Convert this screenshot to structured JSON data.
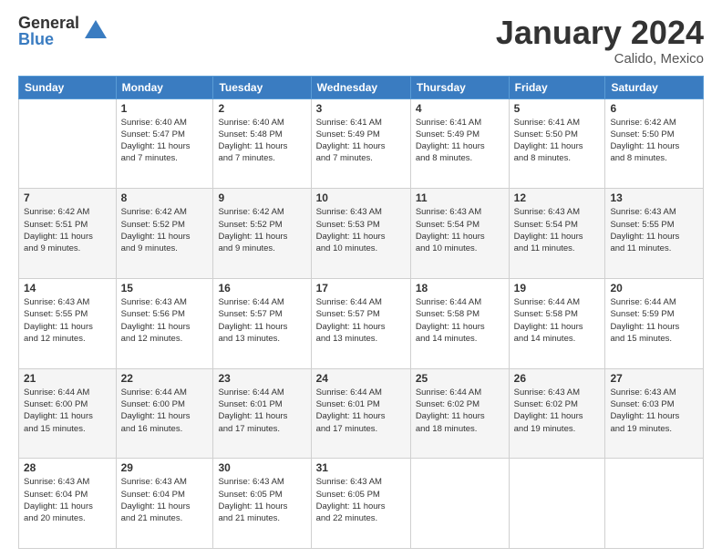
{
  "logo": {
    "general": "General",
    "blue": "Blue"
  },
  "title": "January 2024",
  "location": "Calido, Mexico",
  "days_header": [
    "Sunday",
    "Monday",
    "Tuesday",
    "Wednesday",
    "Thursday",
    "Friday",
    "Saturday"
  ],
  "weeks": [
    [
      {
        "day": "",
        "info": ""
      },
      {
        "day": "1",
        "info": "Sunrise: 6:40 AM\nSunset: 5:47 PM\nDaylight: 11 hours\nand 7 minutes."
      },
      {
        "day": "2",
        "info": "Sunrise: 6:40 AM\nSunset: 5:48 PM\nDaylight: 11 hours\nand 7 minutes."
      },
      {
        "day": "3",
        "info": "Sunrise: 6:41 AM\nSunset: 5:49 PM\nDaylight: 11 hours\nand 7 minutes."
      },
      {
        "day": "4",
        "info": "Sunrise: 6:41 AM\nSunset: 5:49 PM\nDaylight: 11 hours\nand 8 minutes."
      },
      {
        "day": "5",
        "info": "Sunrise: 6:41 AM\nSunset: 5:50 PM\nDaylight: 11 hours\nand 8 minutes."
      },
      {
        "day": "6",
        "info": "Sunrise: 6:42 AM\nSunset: 5:50 PM\nDaylight: 11 hours\nand 8 minutes."
      }
    ],
    [
      {
        "day": "7",
        "info": "Sunrise: 6:42 AM\nSunset: 5:51 PM\nDaylight: 11 hours\nand 9 minutes."
      },
      {
        "day": "8",
        "info": "Sunrise: 6:42 AM\nSunset: 5:52 PM\nDaylight: 11 hours\nand 9 minutes."
      },
      {
        "day": "9",
        "info": "Sunrise: 6:42 AM\nSunset: 5:52 PM\nDaylight: 11 hours\nand 9 minutes."
      },
      {
        "day": "10",
        "info": "Sunrise: 6:43 AM\nSunset: 5:53 PM\nDaylight: 11 hours\nand 10 minutes."
      },
      {
        "day": "11",
        "info": "Sunrise: 6:43 AM\nSunset: 5:54 PM\nDaylight: 11 hours\nand 10 minutes."
      },
      {
        "day": "12",
        "info": "Sunrise: 6:43 AM\nSunset: 5:54 PM\nDaylight: 11 hours\nand 11 minutes."
      },
      {
        "day": "13",
        "info": "Sunrise: 6:43 AM\nSunset: 5:55 PM\nDaylight: 11 hours\nand 11 minutes."
      }
    ],
    [
      {
        "day": "14",
        "info": "Sunrise: 6:43 AM\nSunset: 5:55 PM\nDaylight: 11 hours\nand 12 minutes."
      },
      {
        "day": "15",
        "info": "Sunrise: 6:43 AM\nSunset: 5:56 PM\nDaylight: 11 hours\nand 12 minutes."
      },
      {
        "day": "16",
        "info": "Sunrise: 6:44 AM\nSunset: 5:57 PM\nDaylight: 11 hours\nand 13 minutes."
      },
      {
        "day": "17",
        "info": "Sunrise: 6:44 AM\nSunset: 5:57 PM\nDaylight: 11 hours\nand 13 minutes."
      },
      {
        "day": "18",
        "info": "Sunrise: 6:44 AM\nSunset: 5:58 PM\nDaylight: 11 hours\nand 14 minutes."
      },
      {
        "day": "19",
        "info": "Sunrise: 6:44 AM\nSunset: 5:58 PM\nDaylight: 11 hours\nand 14 minutes."
      },
      {
        "day": "20",
        "info": "Sunrise: 6:44 AM\nSunset: 5:59 PM\nDaylight: 11 hours\nand 15 minutes."
      }
    ],
    [
      {
        "day": "21",
        "info": "Sunrise: 6:44 AM\nSunset: 6:00 PM\nDaylight: 11 hours\nand 15 minutes."
      },
      {
        "day": "22",
        "info": "Sunrise: 6:44 AM\nSunset: 6:00 PM\nDaylight: 11 hours\nand 16 minutes."
      },
      {
        "day": "23",
        "info": "Sunrise: 6:44 AM\nSunset: 6:01 PM\nDaylight: 11 hours\nand 17 minutes."
      },
      {
        "day": "24",
        "info": "Sunrise: 6:44 AM\nSunset: 6:01 PM\nDaylight: 11 hours\nand 17 minutes."
      },
      {
        "day": "25",
        "info": "Sunrise: 6:44 AM\nSunset: 6:02 PM\nDaylight: 11 hours\nand 18 minutes."
      },
      {
        "day": "26",
        "info": "Sunrise: 6:43 AM\nSunset: 6:02 PM\nDaylight: 11 hours\nand 19 minutes."
      },
      {
        "day": "27",
        "info": "Sunrise: 6:43 AM\nSunset: 6:03 PM\nDaylight: 11 hours\nand 19 minutes."
      }
    ],
    [
      {
        "day": "28",
        "info": "Sunrise: 6:43 AM\nSunset: 6:04 PM\nDaylight: 11 hours\nand 20 minutes."
      },
      {
        "day": "29",
        "info": "Sunrise: 6:43 AM\nSunset: 6:04 PM\nDaylight: 11 hours\nand 21 minutes."
      },
      {
        "day": "30",
        "info": "Sunrise: 6:43 AM\nSunset: 6:05 PM\nDaylight: 11 hours\nand 21 minutes."
      },
      {
        "day": "31",
        "info": "Sunrise: 6:43 AM\nSunset: 6:05 PM\nDaylight: 11 hours\nand 22 minutes."
      },
      {
        "day": "",
        "info": ""
      },
      {
        "day": "",
        "info": ""
      },
      {
        "day": "",
        "info": ""
      }
    ]
  ]
}
